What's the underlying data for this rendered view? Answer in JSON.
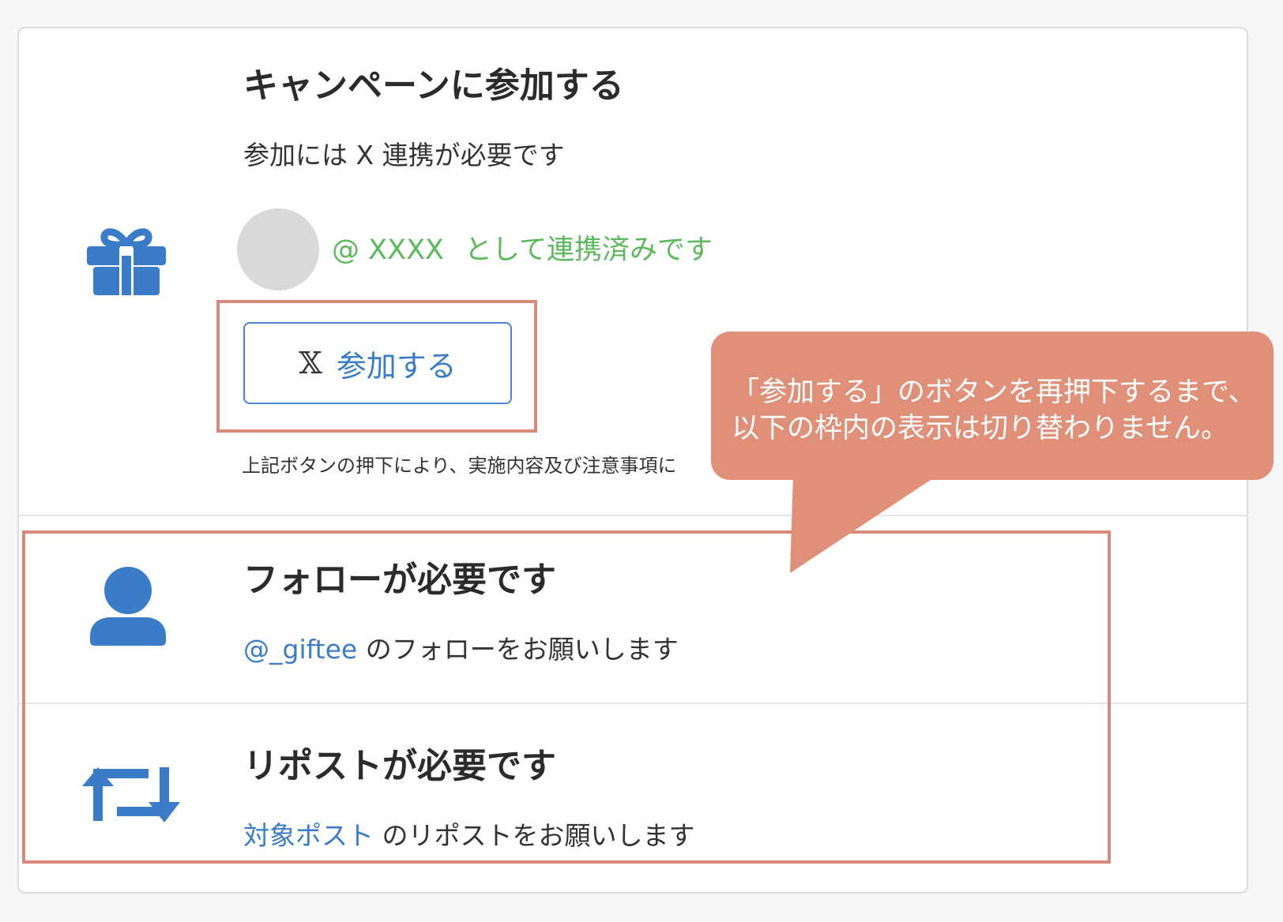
{
  "campaign": {
    "title": "キャンペーンに参加する",
    "requirement": "参加には X 連携が必要です",
    "handle": "@ XXXX",
    "linked_text": "として連携済みです",
    "join_button": {
      "x_glyph": "𝕏",
      "label": "参加する"
    },
    "note": "上記ボタンの押下により、実施内容及び注意事項に"
  },
  "follow": {
    "title": "フォローが必要です",
    "account_link": "@_giftee",
    "rest_text": " のフォローをお願いします"
  },
  "repost": {
    "title": "リポストが必要です",
    "post_link": "対象ポスト",
    "rest_text": " のリポストをお願いします"
  },
  "callout": {
    "line1": "「参加する」のボタンを再押下するまで、",
    "line2": "以下の枠内の表示は切り替わりません。"
  },
  "icons": {
    "campaign": "gift-icon",
    "follow": "user-icon",
    "repost": "repost-icon",
    "join": "x-logo-icon"
  },
  "colors": {
    "icon_blue": "#3a7cc8",
    "link_blue": "#3a7cc8",
    "linked_green": "#5cb85c",
    "highlight": "#d9897a",
    "callout_bg": "#e08f78"
  }
}
